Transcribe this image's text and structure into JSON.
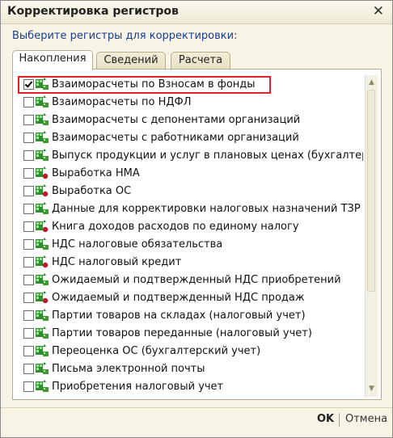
{
  "window": {
    "title": "Корректировка регистров"
  },
  "prompt": "Выберите регистры для корректировки:",
  "tabs": [
    {
      "label": "Накопления",
      "active": true
    },
    {
      "label": "Сведений",
      "active": false
    },
    {
      "label": "Расчета",
      "active": false
    }
  ],
  "registers": [
    {
      "label": "Взаиморасчеты по Взносам в фонды",
      "checked": true,
      "icon": "register-green-icon"
    },
    {
      "label": "Взаиморасчеты по НДФЛ",
      "checked": false,
      "icon": "register-green-icon"
    },
    {
      "label": "Взаиморасчеты с депонентами организаций",
      "checked": false,
      "icon": "register-green-icon"
    },
    {
      "label": "Взаиморасчеты с работниками организаций",
      "checked": false,
      "icon": "register-green-icon"
    },
    {
      "label": "Выпуск продукции и услуг в плановых ценах (бухгалтер...",
      "checked": false,
      "icon": "register-green-icon"
    },
    {
      "label": "Выработка НМА",
      "checked": false,
      "icon": "register-red-icon"
    },
    {
      "label": "Выработка ОС",
      "checked": false,
      "icon": "register-red-icon"
    },
    {
      "label": "Данные для корректировки налоговых назначений ТЗР",
      "checked": false,
      "icon": "register-green-icon"
    },
    {
      "label": "Книга доходов расходов по единому налогу",
      "checked": false,
      "icon": "register-red-icon"
    },
    {
      "label": "НДС налоговые обязательства",
      "checked": false,
      "icon": "register-green-icon"
    },
    {
      "label": "НДС налоговый кредит",
      "checked": false,
      "icon": "register-red-icon"
    },
    {
      "label": "Ожидаемый и подтвержденный НДС приобретений",
      "checked": false,
      "icon": "register-green-icon"
    },
    {
      "label": "Ожидаемый и подтвержденный НДС продаж",
      "checked": false,
      "icon": "register-red-icon"
    },
    {
      "label": "Партии товаров на складах (налоговый учет)",
      "checked": false,
      "icon": "register-green-icon"
    },
    {
      "label": "Партии товаров переданные (налоговый учет)",
      "checked": false,
      "icon": "register-green-icon"
    },
    {
      "label": "Переоценка ОС (бухгалтерский учет)",
      "checked": false,
      "icon": "register-green-icon"
    },
    {
      "label": "Письма электронной почты",
      "checked": false,
      "icon": "register-green-icon"
    },
    {
      "label": "Приобретения налоговый учет",
      "checked": false,
      "icon": "register-green-icon"
    }
  ],
  "footer": {
    "ok_label": "OK",
    "cancel_label": "Отмена"
  },
  "colors": {
    "window_bg": "#f7f4e6",
    "prompt_text": "#1c3c8c",
    "highlight": "#e0202a"
  }
}
